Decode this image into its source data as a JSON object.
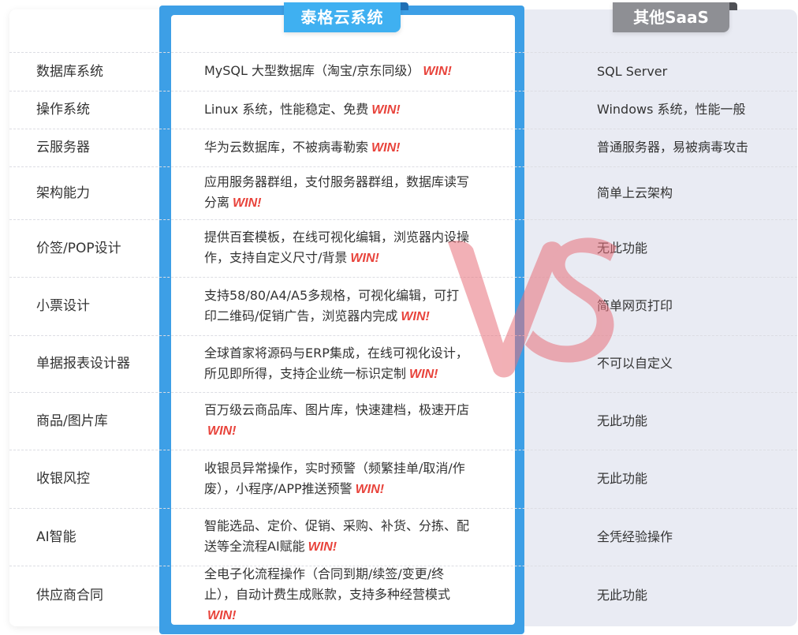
{
  "header": {
    "ours_title": "泰格云系统",
    "other_title": "其他SaaS"
  },
  "win_label": "WIN!",
  "vs_text": "VS",
  "rows": [
    {
      "category": "数据库系统",
      "ours": "MySQL 大型数据库（淘宝/京东同级）",
      "other": "SQL Server"
    },
    {
      "category": "操作系统",
      "ours": "Linux 系统，性能稳定、免费",
      "other": "Windows 系统，性能一般"
    },
    {
      "category": "云服务器",
      "ours": "华为云数据库，不被病毒勒索",
      "other": "普通服务器，易被病毒攻击"
    },
    {
      "category": "架构能力",
      "ours": "应用服务器群组，支付服务器群组，数据库读写分离",
      "other": "简单上云架构"
    },
    {
      "category": "价签/POP设计",
      "ours": "提供百套模板，在线可视化编辑，浏览器内设操作，支持自定义尺寸/背景",
      "other": "无此功能"
    },
    {
      "category": "小票设计",
      "ours": "支持58/80/A4/A5多规格，可视化编辑，可打印二维码/促销广告，浏览器内完成",
      "other": "简单网页打印"
    },
    {
      "category": "单据报表设计器",
      "ours": "全球首家将源码与ERP集成，在线可视化设计，所见即所得，支持企业统一标识定制",
      "other": "不可以自定义"
    },
    {
      "category": "商品/图片库",
      "ours": "百万级云商品库、图片库，快速建档，极速开店",
      "other": "无此功能"
    },
    {
      "category": "收银风控",
      "ours": "收银员异常操作，实时预警（频繁挂单/取消/作废），小程序/APP推送预警",
      "other": "无此功能"
    },
    {
      "category": "AI智能",
      "ours": "智能选品、定价、促销、采购、补货、分拣、配送等全流程AI赋能",
      "other": "全凭经验操作"
    },
    {
      "category": "供应商合同",
      "ours": "全电子化流程操作（合同到期/续签/变更/终止），自动计费生成账款，支持多种经营模式",
      "other": "无此功能"
    }
  ]
}
